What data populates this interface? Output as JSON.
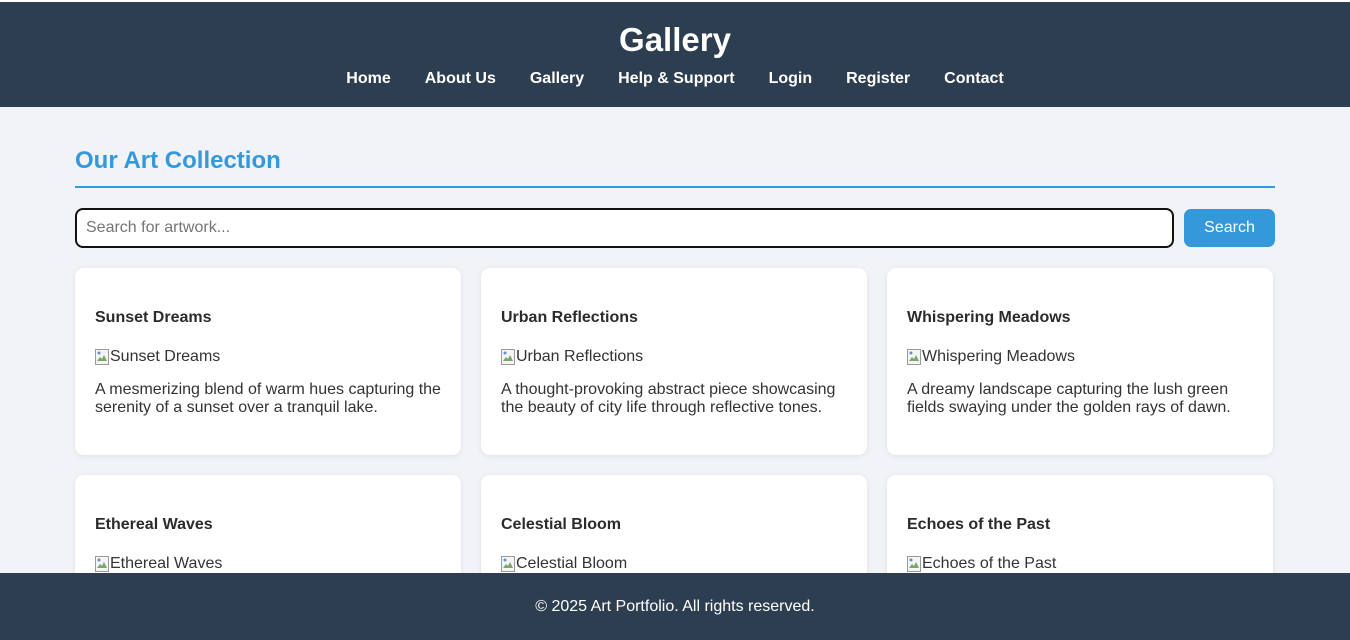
{
  "header": {
    "title": "Gallery",
    "nav": [
      {
        "label": "Home"
      },
      {
        "label": "About Us"
      },
      {
        "label": "Gallery"
      },
      {
        "label": "Help & Support"
      },
      {
        "label": "Login"
      },
      {
        "label": "Register"
      },
      {
        "label": "Contact"
      }
    ]
  },
  "main": {
    "section_title": "Our Art Collection",
    "search": {
      "placeholder": "Search for artwork...",
      "value": "",
      "button_label": "Search"
    },
    "artworks": [
      {
        "title": "Sunset Dreams",
        "image_alt": "Sunset Dreams",
        "description": "A mesmerizing blend of warm hues capturing the serenity of a sunset over a tranquil lake."
      },
      {
        "title": "Urban Reflections",
        "image_alt": "Urban Reflections",
        "description": "A thought-provoking abstract piece showcasing the beauty of city life through reflective tones."
      },
      {
        "title": "Whispering Meadows",
        "image_alt": "Whispering Meadows",
        "description": "A dreamy landscape capturing the lush green fields swaying under the golden rays of dawn."
      },
      {
        "title": "Ethereal Waves",
        "image_alt": "Ethereal Waves",
        "description": ""
      },
      {
        "title": "Celestial Bloom",
        "image_alt": "Celestial Bloom",
        "description": ""
      },
      {
        "title": "Echoes of the Past",
        "image_alt": "Echoes of the Past",
        "description": ""
      }
    ]
  },
  "footer": {
    "text": "© 2025 Art Portfolio. All rights reserved."
  },
  "colors": {
    "header_bg": "#2e3e51",
    "accent": "#3498db",
    "page_bg": "#f2f3f7"
  }
}
